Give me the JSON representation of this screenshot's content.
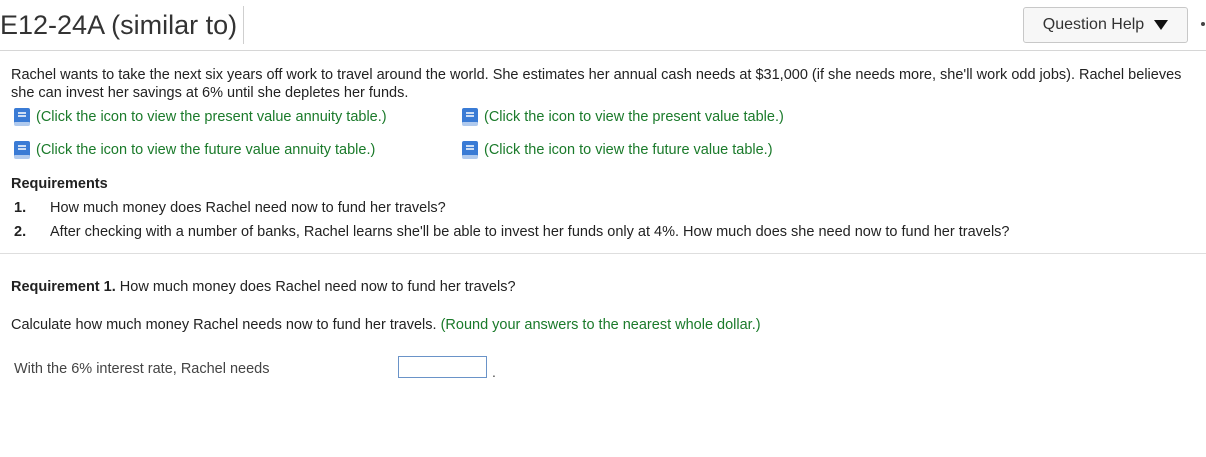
{
  "header": {
    "title": "E12-24A (similar to)",
    "help_label": "Question Help"
  },
  "problem": {
    "text": "Rachel wants to take the next six years off work to travel around the world. She estimates her annual cash needs at $31,000 (if she needs more, she'll work odd jobs). Rachel believes she can invest her savings at 6% until she depletes her funds."
  },
  "links": [
    {
      "label": "(Click the icon to view the present value annuity table.)",
      "icon": "book-icon"
    },
    {
      "label": "(Click the icon to view the present value table.)",
      "icon": "book-icon"
    },
    {
      "label": "(Click the icon to view the future value annuity table.)",
      "icon": "book-icon"
    },
    {
      "label": "(Click the icon to view the future value table.)",
      "icon": "book-icon"
    }
  ],
  "requirements": {
    "title": "Requirements",
    "items": [
      {
        "num": "1.",
        "text": "How much money does Rachel need now to fund her travels?"
      },
      {
        "num": "2.",
        "text": "After checking with a number of banks, Rachel learns she'll be able to invest her funds only at 4%. How much does she need now to fund her travels?"
      }
    ]
  },
  "requirement1": {
    "label": "Requirement 1.",
    "text": "How much money does Rachel need now to fund her travels?"
  },
  "calc": {
    "text": "Calculate how much money Rachel needs now to fund her travels.",
    "hint": "(Round your answers to the nearest whole dollar.)"
  },
  "answer": {
    "label": "With the 6% interest rate, Rachel needs",
    "value": "",
    "suffix": "."
  },
  "colors": {
    "link": "#1a7a2a",
    "icon": "#3a7bd5",
    "input_border": "#6a93c8"
  }
}
